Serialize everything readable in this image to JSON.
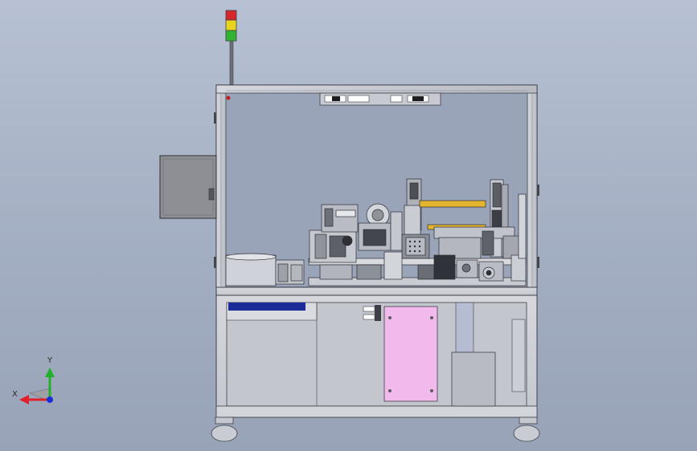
{
  "viewport": {
    "background_top": "#b7c1d3",
    "background_bottom": "#98a3b7"
  },
  "triad": {
    "x_label": "X",
    "y_label": "Y",
    "x_color": "#e0202a",
    "y_color": "#22b02a",
    "z_color": "#1a2fd8"
  },
  "signal_tower": {
    "lights": [
      "red",
      "yellow",
      "green"
    ]
  },
  "colors": {
    "frame": "#c9ccd3",
    "frame_edge": "#3e4047",
    "panel_pink": "#f1b9ec",
    "panel_blue": "#1c2a9a",
    "accent_yellow": "#e3b52d",
    "control_box": "#8d8f95"
  }
}
